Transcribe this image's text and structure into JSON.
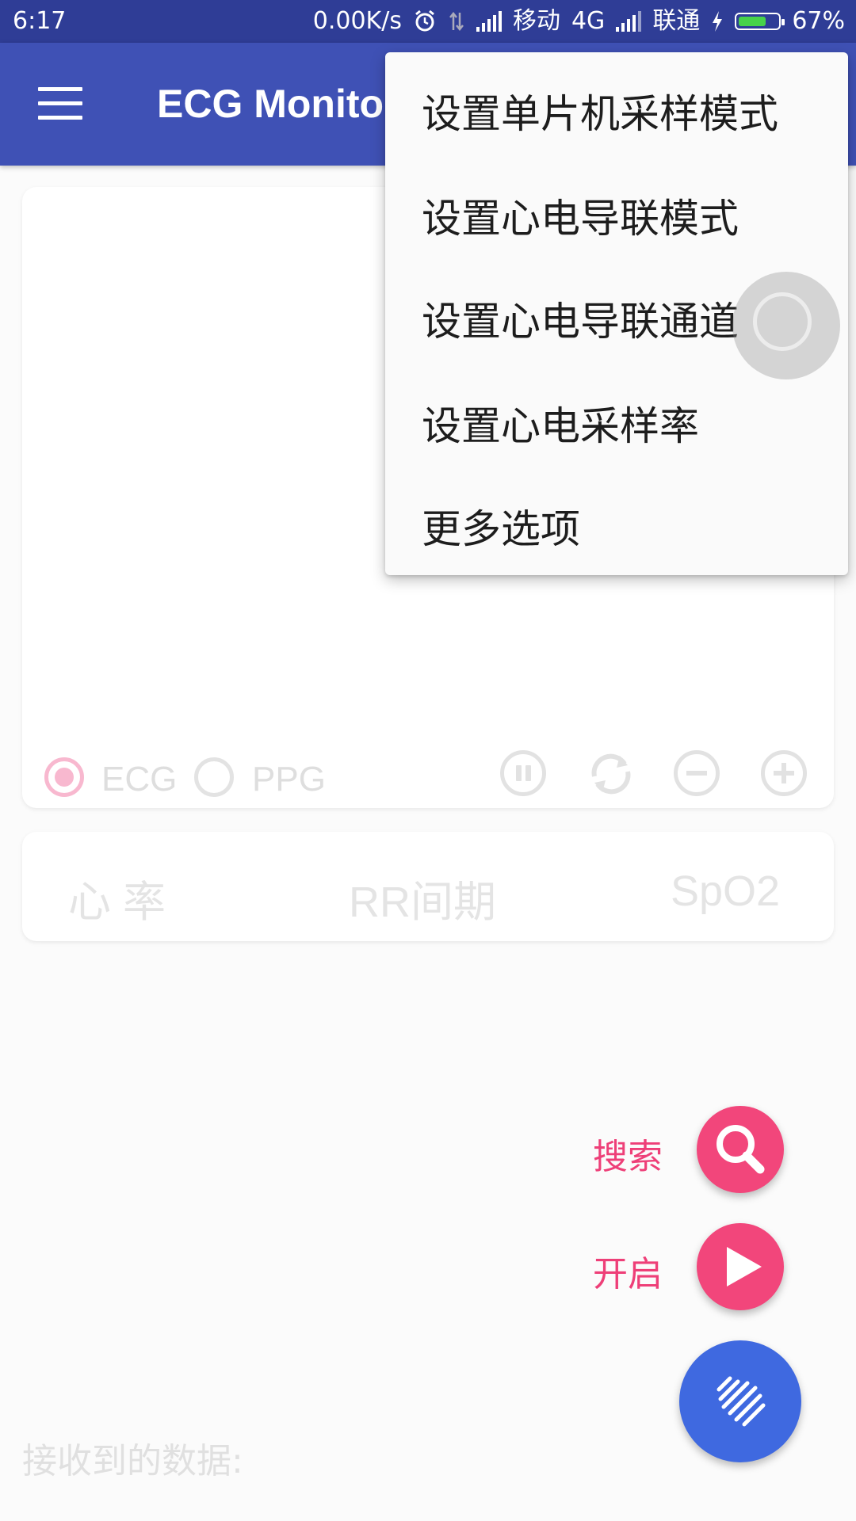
{
  "status_bar": {
    "time": "6:17",
    "net_speed": "0.00K/s",
    "carrier1": "移动",
    "network_type": "4G",
    "carrier2": "联通",
    "battery": "67%"
  },
  "app_bar": {
    "title": "ECG Monito"
  },
  "chart_card": {
    "radio_ecg": "ECG",
    "radio_ppg": "PPG",
    "selected": "ECG"
  },
  "stats": {
    "heart_rate": "心 率",
    "rr_interval": "RR间期",
    "spo2": "SpO2"
  },
  "popup_menu": {
    "items": [
      "设置单片机采样模式",
      "设置心电导联模式",
      "设置心电导联通道",
      "设置心电采样率",
      "更多选项"
    ]
  },
  "fabs": {
    "search_label": "搜索",
    "start_label": "开启"
  },
  "received_label": "接收到的数据:",
  "colors": {
    "app_bar": "#3f51b5",
    "status_bar": "#2f3d96",
    "fab_pink": "#f2467b",
    "fab_blue": "#3f69e0"
  }
}
